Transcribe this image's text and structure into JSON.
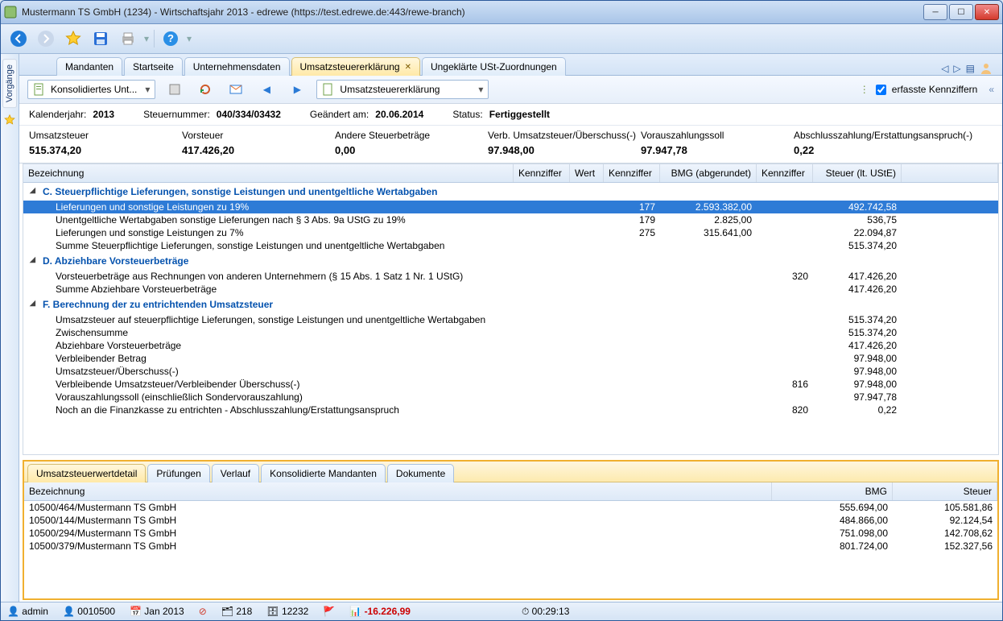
{
  "window": {
    "title": "Mustermann TS GmbH (1234) - Wirtschaftsjahr 2013 - edrewe (https://test.edrewe.de:443/rewe-branch)"
  },
  "tabs": {
    "items": [
      {
        "label": "Mandanten"
      },
      {
        "label": "Startseite"
      },
      {
        "label": "Unternehmensdaten"
      },
      {
        "label": "Umsatzsteuererklärung"
      },
      {
        "label": "Ungeklärte USt-Zuordnungen"
      }
    ]
  },
  "sidebar": {
    "label": "Vorgänge"
  },
  "docbar": {
    "combo1": "Konsolidiertes Unt...",
    "combo2": "Umsatzsteuererklärung",
    "checkbox": "erfasste Kennziffern"
  },
  "meta": {
    "year_lbl": "Kalenderjahr:",
    "year": "2013",
    "stn_lbl": "Steuernummer:",
    "stn": "040/334/03432",
    "chg_lbl": "Geändert am:",
    "chg": "20.06.2014",
    "status_lbl": "Status:",
    "status": "Fertiggestellt"
  },
  "totals": [
    {
      "lbl": "Umsatzsteuer",
      "val": "515.374,20"
    },
    {
      "lbl": "Vorsteuer",
      "val": "417.426,20"
    },
    {
      "lbl": "Andere Steuerbeträge",
      "val": "0,00"
    },
    {
      "lbl": "Verb. Umsatzsteuer/Überschuss(-)",
      "val": "97.948,00"
    },
    {
      "lbl": "Vorauszahlungssoll",
      "val": "97.947,78"
    },
    {
      "lbl": "Abschlusszahlung/Erstattungsanspruch(-)",
      "val": "0,22"
    }
  ],
  "grid": {
    "headers": {
      "bez": "Bezeichnung",
      "kz1": "Kennziffer",
      "w": "Wert",
      "kz2": "Kennziffer",
      "bmg": "BMG (abgerundet)",
      "kz3": "Kennziffer",
      "st": "Steuer (lt. UStE)"
    },
    "sections": [
      {
        "title": "C. Steuerpflichtige Lieferungen, sonstige Leistungen und unentgeltliche Wertabgaben",
        "rows": [
          {
            "bez": "Lieferungen und sonstige Leistungen zu 19%",
            "kz2": "177",
            "bmg": "2.593.382,00",
            "st": "492.742,58",
            "sel": true
          },
          {
            "bez": "Unentgeltliche Wertabgaben sonstige Lieferungen nach § 3 Abs. 9a UStG zu 19%",
            "kz2": "179",
            "bmg": "2.825,00",
            "st": "536,75"
          },
          {
            "bez": "Lieferungen und sonstige Leistungen zu 7%",
            "kz2": "275",
            "bmg": "315.641,00",
            "st": "22.094,87"
          },
          {
            "bez": "Summe Steuerpflichtige Lieferungen, sonstige Leistungen und unentgeltliche Wertabgaben",
            "st": "515.374,20"
          }
        ]
      },
      {
        "title": "D. Abziehbare Vorsteuerbeträge",
        "rows": [
          {
            "bez": "Vorsteuerbeträge aus Rechnungen von anderen Unternehmern (§ 15 Abs. 1 Satz 1 Nr. 1 UStG)",
            "kz3": "320",
            "st": "417.426,20"
          },
          {
            "bez": "Summe Abziehbare Vorsteuerbeträge",
            "st": "417.426,20"
          }
        ]
      },
      {
        "title": "F. Berechnung der zu entrichtenden Umsatzsteuer",
        "rows": [
          {
            "bez": "Umsatzsteuer auf steuerpflichtige Lieferungen, sonstige Leistungen und unentgeltliche Wertabgaben",
            "st": "515.374,20"
          },
          {
            "bez": "Zwischensumme",
            "st": "515.374,20"
          },
          {
            "bez": "Abziehbare Vorsteuerbeträge",
            "st": "417.426,20"
          },
          {
            "bez": "Verbleibender Betrag",
            "st": "97.948,00"
          },
          {
            "bez": "Umsatzsteuer/Überschuss(-)",
            "st": "97.948,00"
          },
          {
            "bez": "Verbleibende Umsatzsteuer/Verbleibender Überschuss(-)",
            "kz3": "816",
            "st": "97.948,00"
          },
          {
            "bez": "Vorauszahlungssoll (einschließlich Sondervorauszahlung)",
            "st": "97.947,78"
          },
          {
            "bez": "Noch an die Finanzkasse zu entrichten - Abschlusszahlung/Erstattungsanspruch",
            "kz3": "820",
            "st": "0,22"
          }
        ]
      }
    ]
  },
  "subtabs": {
    "items": [
      {
        "label": "Umsatzsteuerwertdetail"
      },
      {
        "label": "Prüfungen"
      },
      {
        "label": "Verlauf"
      },
      {
        "label": "Konsolidierte Mandanten"
      },
      {
        "label": "Dokumente"
      }
    ]
  },
  "detail": {
    "headers": {
      "bez": "Bezeichnung",
      "bmg": "BMG",
      "st": "Steuer"
    },
    "rows": [
      {
        "bez": "10500/464/Mustermann TS GmbH",
        "bmg": "555.694,00",
        "st": "105.581,86"
      },
      {
        "bez": "10500/144/Mustermann TS GmbH",
        "bmg": "484.866,00",
        "st": "92.124,54"
      },
      {
        "bez": "10500/294/Mustermann TS GmbH",
        "bmg": "751.098,00",
        "st": "142.708,62"
      },
      {
        "bez": "10500/379/Mustermann TS GmbH",
        "bmg": "801.724,00",
        "st": "152.327,56"
      }
    ]
  },
  "status": {
    "user": "admin",
    "client": "0010500",
    "period": "Jan 2013",
    "cnt1": "218",
    "cnt2": "12232",
    "amount": "-16.226,99",
    "timer": "00:29:13"
  }
}
